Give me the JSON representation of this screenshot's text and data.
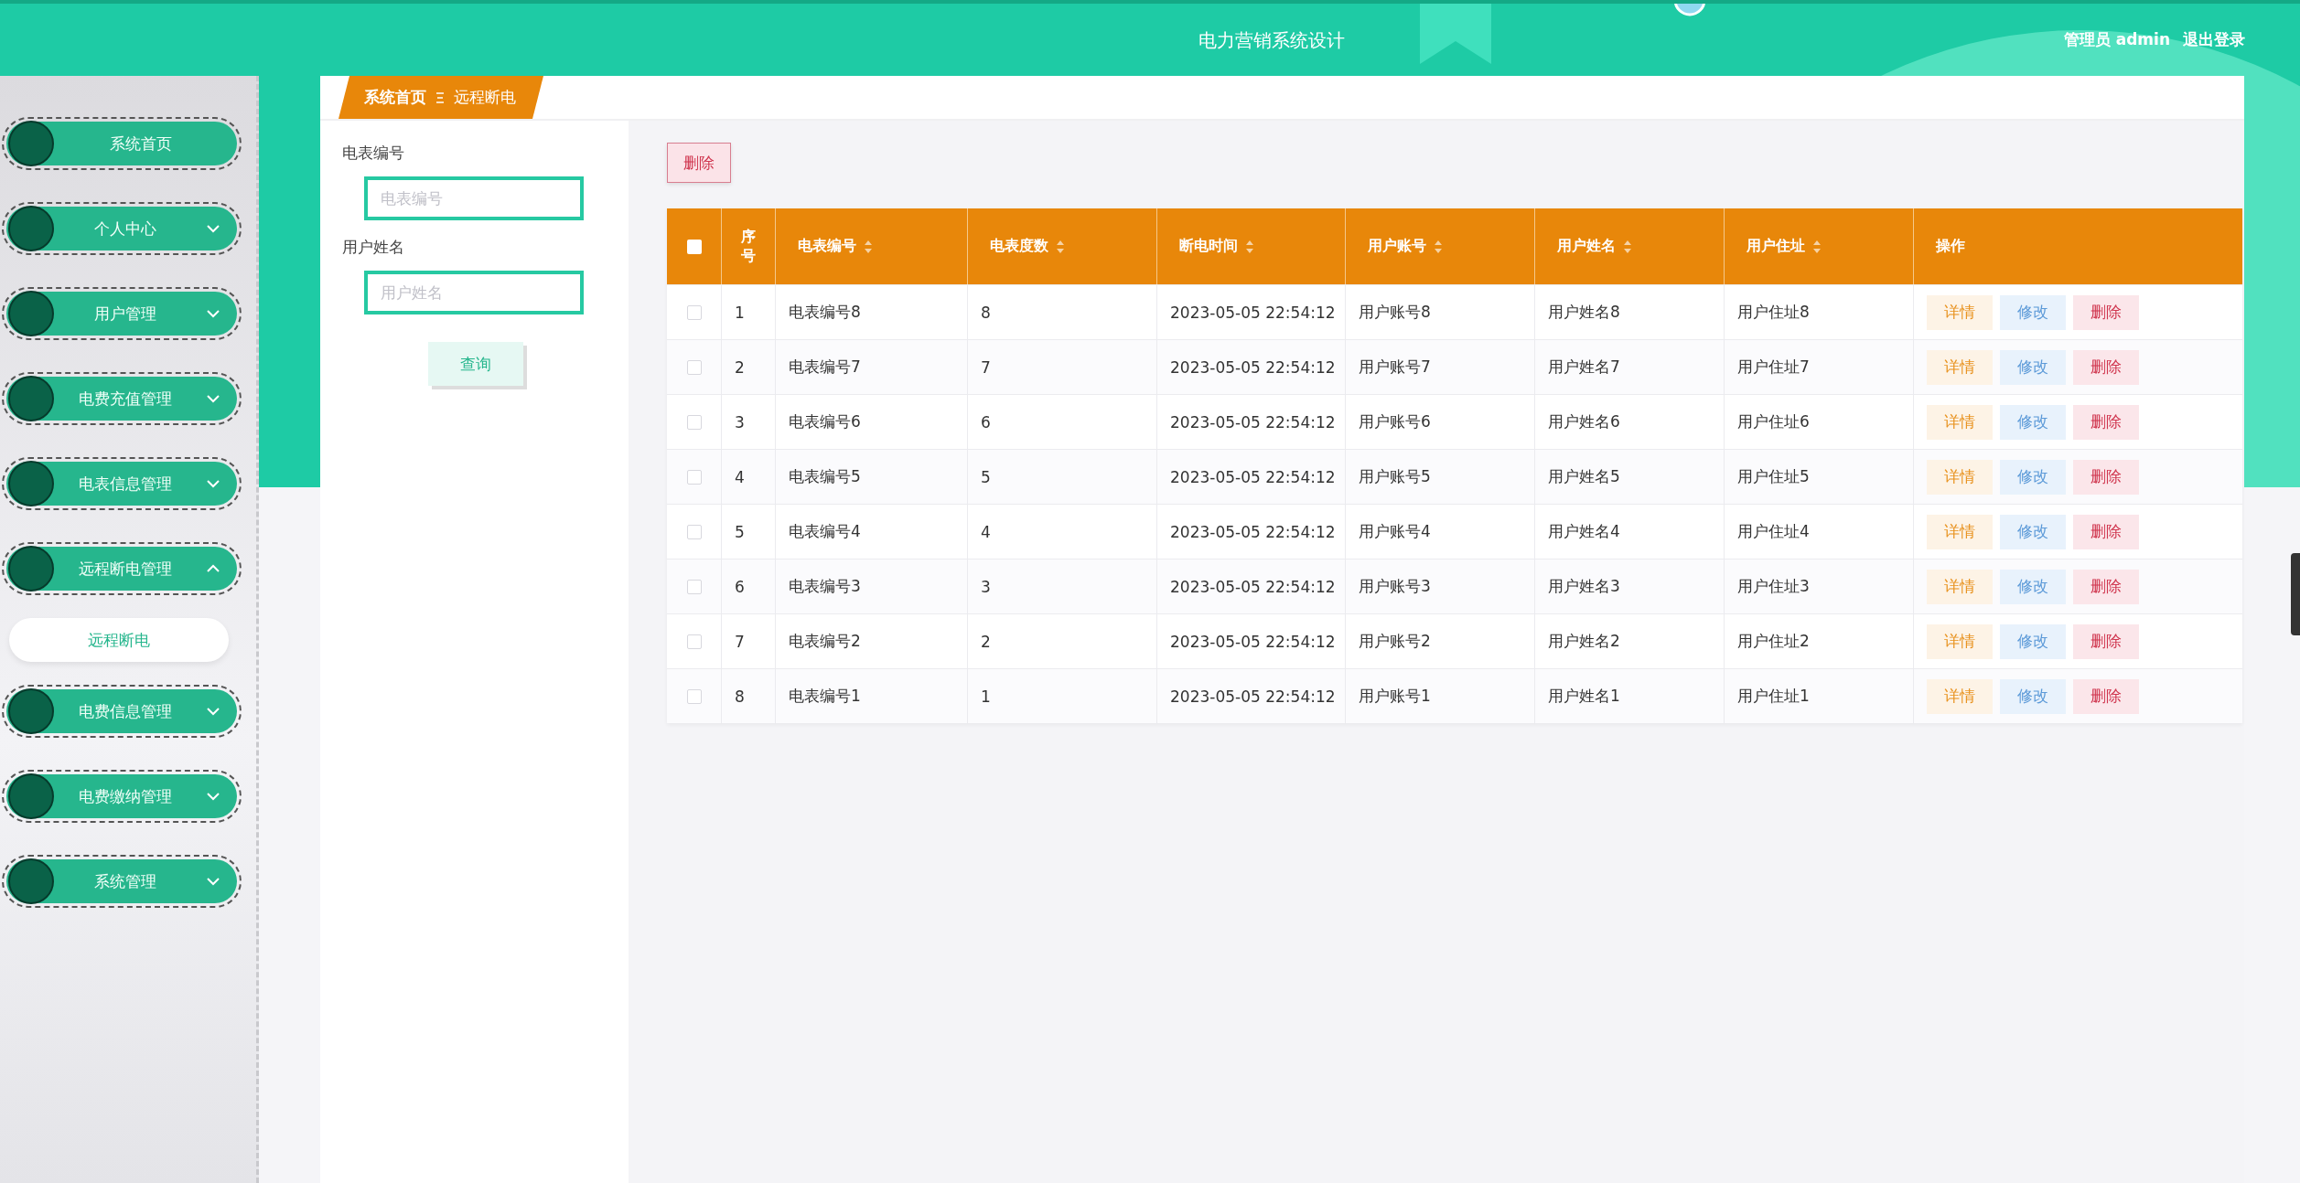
{
  "header": {
    "title": "电力营销系统设计",
    "user": "管理员 admin",
    "logout": "退出登录"
  },
  "sidebar": {
    "items": [
      {
        "label": "系统首页",
        "kind": "link"
      },
      {
        "label": "个人中心",
        "kind": "menu",
        "expanded": false
      },
      {
        "label": "用户管理",
        "kind": "menu",
        "expanded": false
      },
      {
        "label": "电费充值管理",
        "kind": "menu",
        "expanded": false
      },
      {
        "label": "电表信息管理",
        "kind": "menu",
        "expanded": false
      },
      {
        "label": "远程断电管理",
        "kind": "menu",
        "expanded": true,
        "children": [
          {
            "label": "远程断电",
            "selected": true
          }
        ]
      },
      {
        "label": "电费信息管理",
        "kind": "menu",
        "expanded": false
      },
      {
        "label": "电费缴纳管理",
        "kind": "menu",
        "expanded": false
      },
      {
        "label": "系统管理",
        "kind": "menu",
        "expanded": false
      }
    ]
  },
  "breadcrumb": [
    "系统首页",
    "远程断电"
  ],
  "filters": [
    {
      "label": "电表编号",
      "placeholder": "电表编号"
    },
    {
      "label": "用户姓名",
      "placeholder": "用户姓名"
    }
  ],
  "search_button": "查询",
  "bulk_delete": "删除",
  "table": {
    "select_all": {
      "checked": false
    },
    "columns": [
      {
        "label": "序号",
        "sortable": false
      },
      {
        "label": "电表编号",
        "sortable": true
      },
      {
        "label": "电表度数",
        "sortable": true
      },
      {
        "label": "断电时间",
        "sortable": true
      },
      {
        "label": "用户账号",
        "sortable": true
      },
      {
        "label": "用户姓名",
        "sortable": true
      },
      {
        "label": "用户住址",
        "sortable": true
      },
      {
        "label": "操作",
        "sortable": false
      }
    ],
    "rows": [
      {
        "checked": false,
        "cells": [
          "1",
          "电表编号8",
          "8",
          "2023-05-05 22:54:12",
          "用户账号8",
          "用户姓名8",
          "用户住址8"
        ],
        "actions": [
          {
            "label": "详情",
            "kind": "detail"
          },
          {
            "label": "修改",
            "kind": "edit"
          },
          {
            "label": "删除",
            "kind": "delete"
          }
        ]
      },
      {
        "checked": false,
        "cells": [
          "2",
          "电表编号7",
          "7",
          "2023-05-05 22:54:12",
          "用户账号7",
          "用户姓名7",
          "用户住址7"
        ],
        "actions": [
          {
            "label": "详情",
            "kind": "detail"
          },
          {
            "label": "修改",
            "kind": "edit"
          },
          {
            "label": "删除",
            "kind": "delete"
          }
        ]
      },
      {
        "checked": false,
        "cells": [
          "3",
          "电表编号6",
          "6",
          "2023-05-05 22:54:12",
          "用户账号6",
          "用户姓名6",
          "用户住址6"
        ],
        "actions": [
          {
            "label": "详情",
            "kind": "detail"
          },
          {
            "label": "修改",
            "kind": "edit"
          },
          {
            "label": "删除",
            "kind": "delete"
          }
        ]
      },
      {
        "checked": false,
        "cells": [
          "4",
          "电表编号5",
          "5",
          "2023-05-05 22:54:12",
          "用户账号5",
          "用户姓名5",
          "用户住址5"
        ],
        "actions": [
          {
            "label": "详情",
            "kind": "detail"
          },
          {
            "label": "修改",
            "kind": "edit"
          },
          {
            "label": "删除",
            "kind": "delete"
          }
        ]
      },
      {
        "checked": false,
        "cells": [
          "5",
          "电表编号4",
          "4",
          "2023-05-05 22:54:12",
          "用户账号4",
          "用户姓名4",
          "用户住址4"
        ],
        "actions": [
          {
            "label": "详情",
            "kind": "detail"
          },
          {
            "label": "修改",
            "kind": "edit"
          },
          {
            "label": "删除",
            "kind": "delete"
          }
        ]
      },
      {
        "checked": false,
        "cells": [
          "6",
          "电表编号3",
          "3",
          "2023-05-05 22:54:12",
          "用户账号3",
          "用户姓名3",
          "用户住址3"
        ],
        "actions": [
          {
            "label": "详情",
            "kind": "detail"
          },
          {
            "label": "修改",
            "kind": "edit"
          },
          {
            "label": "删除",
            "kind": "delete"
          }
        ]
      },
      {
        "checked": false,
        "cells": [
          "7",
          "电表编号2",
          "2",
          "2023-05-05 22:54:12",
          "用户账号2",
          "用户姓名2",
          "用户住址2"
        ],
        "actions": [
          {
            "label": "详情",
            "kind": "detail"
          },
          {
            "label": "修改",
            "kind": "edit"
          },
          {
            "label": "删除",
            "kind": "delete"
          }
        ]
      },
      {
        "checked": false,
        "cells": [
          "8",
          "电表编号1",
          "1",
          "2023-05-05 22:54:12",
          "用户账号1",
          "用户姓名1",
          "用户住址1"
        ],
        "actions": [
          {
            "label": "详情",
            "kind": "detail"
          },
          {
            "label": "修改",
            "kind": "edit"
          },
          {
            "label": "删除",
            "kind": "delete"
          }
        ]
      }
    ]
  }
}
